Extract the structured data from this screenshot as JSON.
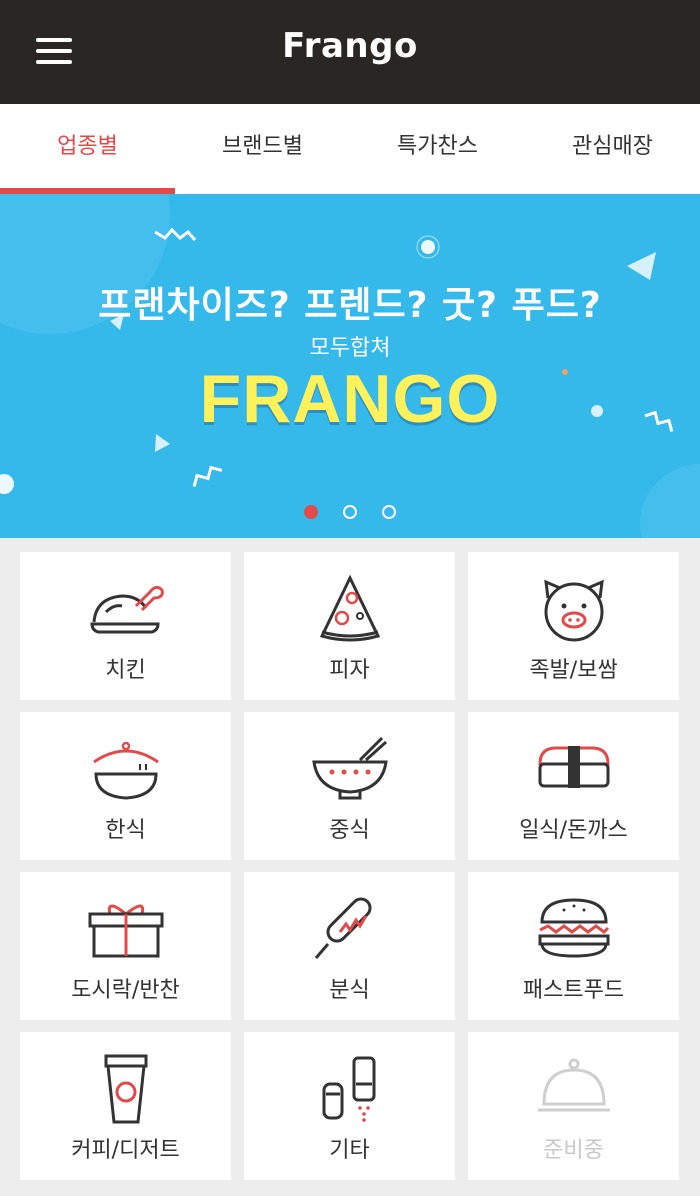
{
  "header": {
    "logo": "Frango",
    "menu_icon": "hamburger-icon"
  },
  "tabs": [
    {
      "label": "업종별",
      "active": true
    },
    {
      "label": "브랜드별",
      "active": false
    },
    {
      "label": "특가찬스",
      "active": false
    },
    {
      "label": "관심매장",
      "active": false
    }
  ],
  "banner": {
    "line1": "프랜차이즈? 프렌드? 굿? 푸드?",
    "line2": "모두합쳐",
    "brand": "FRANGO",
    "slides": 3,
    "active_slide": 1
  },
  "categories": [
    {
      "label": "치킨",
      "icon": "chicken-icon"
    },
    {
      "label": "피자",
      "icon": "pizza-icon"
    },
    {
      "label": "족발/보쌈",
      "icon": "pig-icon"
    },
    {
      "label": "한식",
      "icon": "pot-icon"
    },
    {
      "label": "중식",
      "icon": "noodle-bowl-icon"
    },
    {
      "label": "일식/돈까스",
      "icon": "sushi-icon"
    },
    {
      "label": "도시락/반찬",
      "icon": "lunchbox-icon"
    },
    {
      "label": "분식",
      "icon": "corndog-icon"
    },
    {
      "label": "패스트푸드",
      "icon": "burger-icon"
    },
    {
      "label": "커피/디저트",
      "icon": "coffee-cup-icon"
    },
    {
      "label": "기타",
      "icon": "condiments-icon"
    },
    {
      "label": "준비중",
      "icon": "cloche-icon",
      "disabled": true
    }
  ],
  "colors": {
    "header_bg": "#2a2624",
    "accent": "#e24a4a",
    "banner_bg": "#35b8ea",
    "brand_yellow": "#fff15a"
  }
}
